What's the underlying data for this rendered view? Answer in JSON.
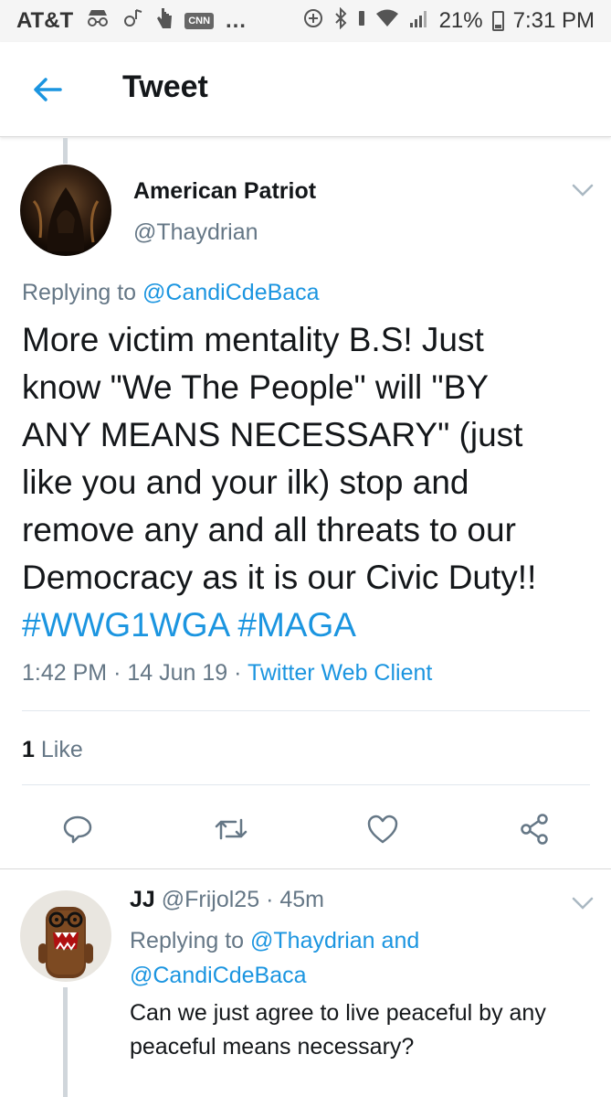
{
  "status_bar": {
    "carrier": "AT&T",
    "battery": "21%",
    "time": "7:31 PM"
  },
  "header": {
    "title": "Tweet"
  },
  "tweet": {
    "display_name": "American Patriot",
    "handle": "@Thaydrian",
    "replying_prefix": "Replying to",
    "replying_to": "@CandiCdeBaca",
    "text_lines": [
      "More victim mentality B.S! Just",
      "know \"We The People\" will \"BY",
      "ANY MEANS NECESSARY\" (just",
      "like you and your ilk) stop and",
      "remove any and all threats to our",
      "Democracy as it is our Civic Duty!!"
    ],
    "hashtags": "#WWG1WGA #MAGA",
    "time": "1:42 PM",
    "date": "14 Jun 19",
    "sep": "·",
    "client": "Twitter Web Client",
    "like_count": "1",
    "like_label": "Like"
  },
  "reply": {
    "display_name": "JJ",
    "handle": "@Frijol25",
    "sep": "·",
    "age": "45m",
    "replying_prefix": "Replying to",
    "replying_to_1": "@Thaydrian",
    "replying_and": "and",
    "replying_to_2": "@CandiCdeBaca",
    "text_lines": [
      "Can we just agree to live peaceful by any",
      "peaceful means necessary?"
    ]
  },
  "colors": {
    "link": "#1b95e0",
    "muted": "#657786",
    "text": "#14171a"
  },
  "icons": [
    "back-arrow-icon",
    "chevron-down-icon",
    "reply-icon",
    "retweet-icon",
    "like-icon",
    "share-icon"
  ]
}
